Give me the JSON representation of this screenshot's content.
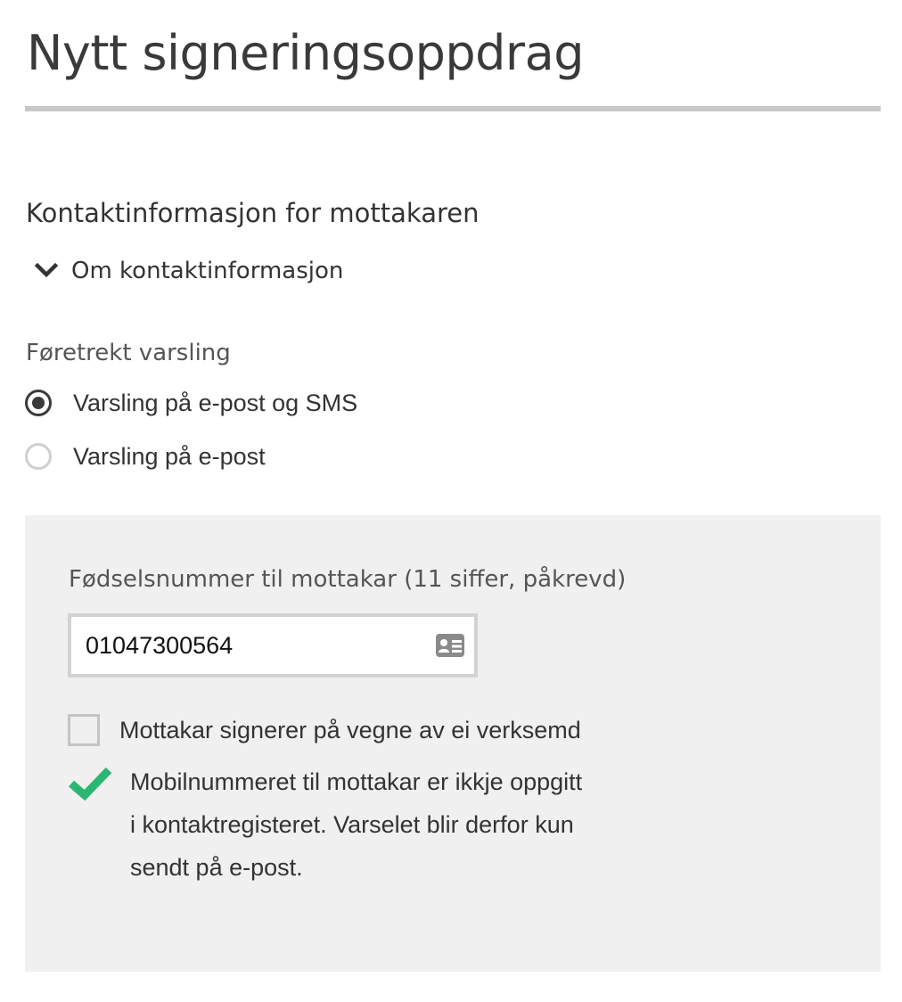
{
  "page": {
    "title": "Nytt signeringsoppdrag"
  },
  "contact_section": {
    "heading": "Kontaktinformasjon for mottakaren",
    "disclosure_label": "Om kontaktinformasjon",
    "disclosure_icon": "chevron-down-icon"
  },
  "notification": {
    "label": "Føretrekt varsling",
    "options": [
      {
        "label": "Varsling på e-post og SMS",
        "checked": true
      },
      {
        "label": "Varsling på e-post",
        "checked": false
      }
    ]
  },
  "recipient_panel": {
    "ssn_label": "Fødselsnummer til mottakar (11 siffer, påkrevd)",
    "ssn_value": "01047300564",
    "ssn_icon": "id-card-icon",
    "org_checkbox_label": "Mottakar signerer på vegne av ei verksemd",
    "org_checkbox_checked": false,
    "info_icon": "checkmark-icon",
    "info_text": "Mobilnummeret til mottakar er ikkje oppgitt i kontaktregisteret. Varselet blir derfor kun sendt på e-post."
  },
  "colors": {
    "text": "#333333",
    "rule": "#c8c8c8",
    "panel_background": "#f0f0f0",
    "radio_selected": "#3a3a3a",
    "check_green": "#2bb673"
  }
}
